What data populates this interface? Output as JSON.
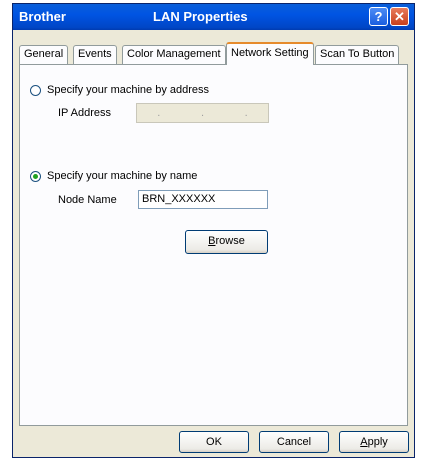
{
  "window": {
    "app_name": "Brother",
    "title": "LAN Properties",
    "help_symbol": "?",
    "close_symbol": "✕"
  },
  "tabs": [
    {
      "label": "General"
    },
    {
      "label": "Events"
    },
    {
      "label": "Color Management"
    },
    {
      "label": "Network Setting",
      "active": true
    },
    {
      "label": "Scan To Button"
    }
  ],
  "network": {
    "by_address_label": "Specify your machine by address",
    "by_address_selected": false,
    "ip_label": "IP Address",
    "ip_dots": [
      ".",
      ".",
      "."
    ],
    "by_name_label": "Specify your machine by name",
    "by_name_selected": true,
    "node_label": "Node Name",
    "node_value": "BRN_XXXXXX",
    "browse_label": "Browse",
    "browse_accel": "B",
    "browse_rest": "rowse"
  },
  "buttons": {
    "ok": "OK",
    "cancel": "Cancel",
    "apply_accel": "A",
    "apply_rest": "pply"
  }
}
